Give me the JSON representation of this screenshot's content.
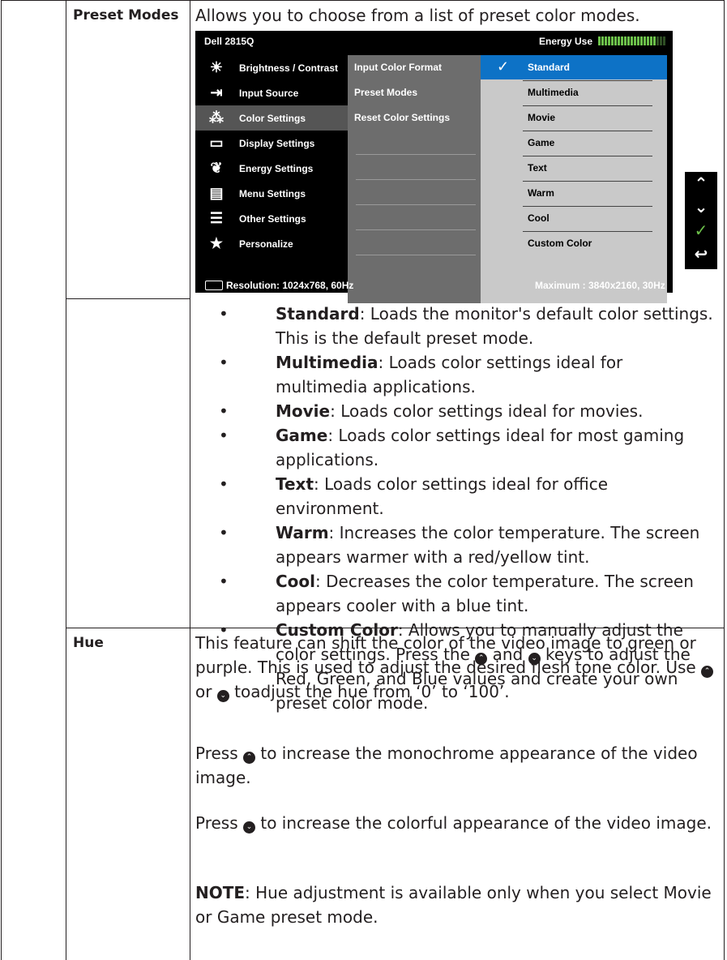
{
  "preset_modes": {
    "label": "Preset Modes",
    "intro": "Allows you to choose from a list of preset color modes."
  },
  "osd": {
    "model": "Dell 2815Q",
    "energy_label": "Energy Use",
    "energy_level": 0.85,
    "menu": [
      {
        "icon": "brightness-icon",
        "glyph": "☀",
        "label": "Brightness / Contrast"
      },
      {
        "icon": "input-source-icon",
        "glyph": "⇥",
        "label": "Input Source"
      },
      {
        "icon": "color-settings-icon",
        "glyph": "⁂",
        "label": "Color Settings"
      },
      {
        "icon": "display-settings-icon",
        "glyph": "▭",
        "label": "Display Settings"
      },
      {
        "icon": "energy-settings-icon",
        "glyph": "❦",
        "label": "Energy Settings"
      },
      {
        "icon": "menu-settings-icon",
        "glyph": "▤",
        "label": "Menu Settings"
      },
      {
        "icon": "other-settings-icon",
        "glyph": "☰",
        "label": "Other Settings"
      },
      {
        "icon": "personalize-icon",
        "glyph": "★",
        "label": "Personalize"
      }
    ],
    "submenu": [
      "Input Color Format",
      "Preset Modes",
      "Reset Color Settings"
    ],
    "modes": [
      "Standard",
      "Multimedia",
      "Movie",
      "Game",
      "Text",
      "Warm",
      "Cool",
      "Custom Color"
    ],
    "check": "✓",
    "resolution": "Resolution: 1024x768,  60Hz",
    "maximum": "Maximum : 3840x2160,  30Hz",
    "nav": [
      {
        "icon": "up-icon",
        "glyph": "⌃"
      },
      {
        "icon": "down-icon",
        "glyph": "⌄"
      },
      {
        "icon": "ok-icon",
        "glyph": "✓"
      },
      {
        "icon": "back-icon",
        "glyph": "↩"
      }
    ]
  },
  "bullets": [
    {
      "term": "Standard",
      "text": ": Loads the monitor's default color settings. This is the default preset mode."
    },
    {
      "term": "Multimedia",
      "text": ": Loads color settings ideal for multimedia applications."
    },
    {
      "term": "Movie",
      "text": ": Loads color settings ideal for movies."
    },
    {
      "term": "Game",
      "text": ": Loads color settings ideal for most gaming applications."
    },
    {
      "term": "Text",
      "text": ": Loads color settings ideal for office environment."
    },
    {
      "term": "Warm",
      "text": ": Increases the color temperature. The screen appears warmer with a red/yellow tint."
    },
    {
      "term": "Cool",
      "text": ": Decreases the color temperature. The screen appears cooler with a blue tint."
    }
  ],
  "custom": {
    "term": "Custom Color",
    "text1": ": Allows you to manually adjust the color settings. Press the ",
    "and": " and ",
    "text2": " keys to adjust the Red, Green, and Blue values and create your own preset color mode."
  },
  "hue": {
    "label": "Hue",
    "p1a": "This feature can shift the color of the video image to green or purple. This is used to adjust the desired flesh tone color. Use ",
    "or": " or ",
    "p1b": " toadjust the hue from ‘0’ to ‘100’.",
    "press": "Press ",
    "p2": " to increase the monochrome appearance of the video image.",
    "p3": " to increase the colorful appearance of the video image.",
    "note_label": "NOTE",
    "note_text": ": Hue adjustment is available only when you select Movie or Game preset mode."
  },
  "key_up_glyph": "⌃",
  "key_down_glyph": "⌄",
  "colors": {
    "highlight": "#0d72c6",
    "energy": "#6cc04a",
    "ok": "#6cc04a"
  }
}
